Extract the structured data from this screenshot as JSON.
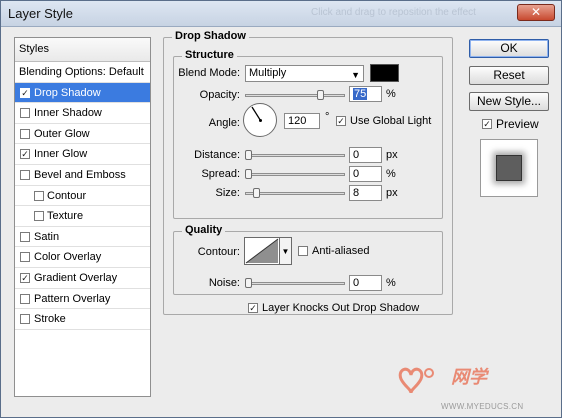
{
  "window": {
    "title": "Layer Style",
    "close_glyph": "✕",
    "ghost_title": "Click and drag to reposition the effect"
  },
  "styles_panel": {
    "header": "Styles",
    "items": [
      {
        "label": "Blending Options: Default",
        "checked": null,
        "selected": false,
        "sub": false
      },
      {
        "label": "Drop Shadow",
        "checked": true,
        "selected": true,
        "sub": false
      },
      {
        "label": "Inner Shadow",
        "checked": false,
        "selected": false,
        "sub": false
      },
      {
        "label": "Outer Glow",
        "checked": false,
        "selected": false,
        "sub": false
      },
      {
        "label": "Inner Glow",
        "checked": true,
        "selected": false,
        "sub": false
      },
      {
        "label": "Bevel and Emboss",
        "checked": false,
        "selected": false,
        "sub": false
      },
      {
        "label": "Contour",
        "checked": false,
        "selected": false,
        "sub": true
      },
      {
        "label": "Texture",
        "checked": false,
        "selected": false,
        "sub": true
      },
      {
        "label": "Satin",
        "checked": false,
        "selected": false,
        "sub": false
      },
      {
        "label": "Color Overlay",
        "checked": false,
        "selected": false,
        "sub": false
      },
      {
        "label": "Gradient Overlay",
        "checked": true,
        "selected": false,
        "sub": false
      },
      {
        "label": "Pattern Overlay",
        "checked": false,
        "selected": false,
        "sub": false
      },
      {
        "label": "Stroke",
        "checked": false,
        "selected": false,
        "sub": false
      }
    ]
  },
  "drop_shadow": {
    "group_label": "Drop Shadow",
    "structure": {
      "label": "Structure",
      "blend_mode_label": "Blend Mode:",
      "blend_mode_value": "Multiply",
      "shadow_color": "#000000",
      "opacity_label": "Opacity:",
      "opacity_value": "75",
      "opacity_level": 0.75,
      "opacity_unit": "%",
      "angle_label": "Angle:",
      "angle_value": "120",
      "angle_unit": "°",
      "use_global_light_label": "Use Global Light",
      "use_global_light": true,
      "distance_label": "Distance:",
      "distance_value": "0",
      "distance_unit": "px",
      "spread_label": "Spread:",
      "spread_value": "0",
      "spread_unit": "%",
      "size_label": "Size:",
      "size_value": "8",
      "size_unit": "px"
    },
    "quality": {
      "label": "Quality",
      "contour_label": "Contour:",
      "anti_aliased_label": "Anti-aliased",
      "anti_aliased": false,
      "noise_label": "Noise:",
      "noise_value": "0",
      "noise_unit": "%"
    },
    "knockout_label": "Layer Knocks Out Drop Shadow",
    "knockout": true
  },
  "buttons": {
    "ok": "OK",
    "reset": "Reset",
    "new_style": "New Style...",
    "preview_label": "Preview",
    "preview_checked": true
  },
  "watermark": {
    "brand": "网学",
    "url": "WWW.MYEDUCS.CN"
  },
  "colors": {
    "selection": "#3b7be0",
    "watermark": "#e98a74"
  }
}
